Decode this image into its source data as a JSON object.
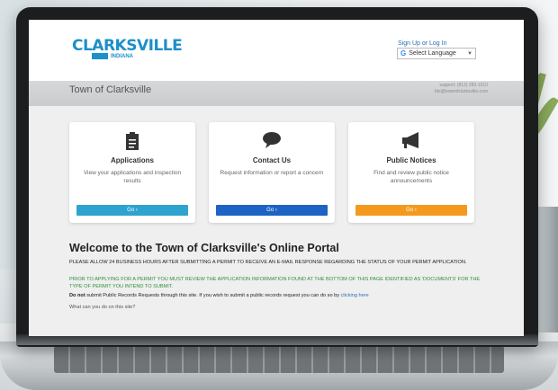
{
  "header": {
    "logo_word": "CLARKSVILLE",
    "logo_state": "INDIANA",
    "signup_text": "Sign Up or Log In",
    "language_label": "Select Language"
  },
  "band": {
    "town_name": "Town of Clarksville",
    "support_phone": "support: (812) 283-1510",
    "support_email": "bts@townofclarksville.com"
  },
  "cards": [
    {
      "title": "Applications",
      "description": "View your applications and inspection results",
      "button": "Go ›",
      "color": "#2ea3cf",
      "icon": "clipboard-icon"
    },
    {
      "title": "Contact Us",
      "description": "Request information or report a concern",
      "button": "Go ›",
      "color": "#1c63c4",
      "icon": "speech-bubble-icon"
    },
    {
      "title": "Public Notices",
      "description": "Find and review public notice announcements",
      "button": "Go ›",
      "color": "#f39a1e",
      "icon": "megaphone-icon"
    }
  ],
  "welcome": {
    "heading": "Welcome to the Town of Clarksville's Online Portal",
    "notice_1": "PLEASE ALLOW 24 BUSINESS HOURS AFTER SUBMITTING A PERMIT TO RECEIVE AN E-MAIL RESPONSE REGARDING THE STATUS OF YOUR PERMIT APPLICATION.",
    "notice_2": "PRIOR TO APPLYING FOR A PERMIT YOU MUST REVIEW THE APPLICATION INFORMATION FOUND AT THE BOTTOM OF THIS PAGE IDENTIFIED AS 'DOCUMENTS' FOR THE TYPE OF PERMIT YOU INTEND TO SUBMIT.",
    "records_bold": "Do not",
    "records_text": " submit Public Records Requests through this site.  If you wish to submit a public records request you can do so by ",
    "records_link": "clicking here",
    "question": "What can you do on this site?"
  }
}
